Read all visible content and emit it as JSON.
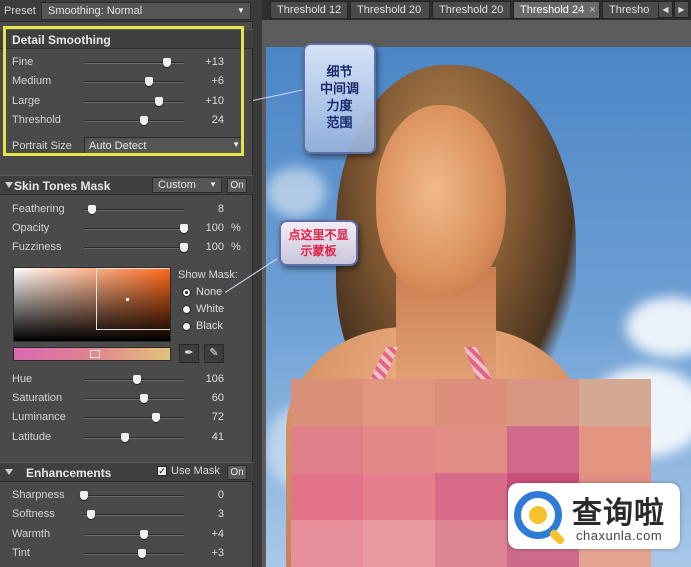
{
  "preset": {
    "label": "Preset",
    "value": "Smoothing: Normal"
  },
  "detail_smoothing": {
    "title": "Detail Smoothing",
    "rows": [
      {
        "label": "Fine",
        "value": "+13",
        "level": 0.83
      },
      {
        "label": "Medium",
        "value": "+6",
        "level": 0.65
      },
      {
        "label": "Large",
        "value": "+10",
        "level": 0.75
      },
      {
        "label": "Threshold",
        "value": "24",
        "level": 0.6
      }
    ],
    "portrait_label": "Portrait Size",
    "portrait_value": "Auto Detect"
  },
  "skin_tones": {
    "title": "Skin Tones Mask",
    "mode": "Custom",
    "on_label": "On",
    "rows": [
      {
        "label": "Feathering",
        "value": "8",
        "unit": "",
        "level": 0.08
      },
      {
        "label": "Opacity",
        "value": "100",
        "unit": "%",
        "level": 1.0
      },
      {
        "label": "Fuzziness",
        "value": "100",
        "unit": "%",
        "level": 1.0
      }
    ],
    "show_mask_label": "Show Mask:",
    "mask_options": [
      {
        "label": "None",
        "selected": true
      },
      {
        "label": "White",
        "selected": false
      },
      {
        "label": "Black",
        "selected": false
      }
    ],
    "hsl_rows": [
      {
        "label": "Hue",
        "value": "106",
        "level": 0.53
      },
      {
        "label": "Saturation",
        "value": "60",
        "level": 0.6
      },
      {
        "label": "Luminance",
        "value": "72",
        "level": 0.72
      },
      {
        "label": "Latitude",
        "value": "41",
        "level": 0.41
      }
    ]
  },
  "enhancements": {
    "title": "Enhancements",
    "use_mask_label": "Use Mask",
    "use_mask_checked": true,
    "on_label": "On",
    "rows": [
      {
        "label": "Sharpness",
        "value": "0",
        "level": 0.0
      },
      {
        "label": "Softness",
        "value": "3",
        "level": 0.07
      },
      {
        "label": "Warmth",
        "value": "+4",
        "level": 0.6
      },
      {
        "label": "Tint",
        "value": "+3",
        "level": 0.58
      }
    ]
  },
  "tabs": [
    {
      "label": "Threshold 12",
      "active": false,
      "closable": false
    },
    {
      "label": "Threshold 20",
      "active": false,
      "closable": false
    },
    {
      "label": "Threshold 20",
      "active": false,
      "closable": false
    },
    {
      "label": "Threshold 24",
      "active": true,
      "closable": true
    },
    {
      "label": "Thresho",
      "active": false,
      "closable": false
    }
  ],
  "tab_close": "×",
  "tab_nav": {
    "prev": "◀",
    "next": "▶"
  },
  "annotations": {
    "bubble1_lines": [
      "细节",
      "中间调",
      "力度",
      "范围"
    ],
    "bubble2_lines": [
      "点这里不显",
      "示蒙板"
    ]
  },
  "pixel_colors": [
    "#d98f78",
    "#e1967f",
    "#dc8f7a",
    "#d89583",
    "#d4a994",
    "#de7f8a",
    "#e38a86",
    "#e18d84",
    "#d1698a",
    "#e2967f",
    "#e27389",
    "#e47f8b",
    "#d86b8a",
    "#ca4f7a",
    "#e48f84",
    "#e88f9c",
    "#e89aa0",
    "#dd8492",
    "#cc6a8a",
    "#e5a490"
  ],
  "watermark": {
    "brand_cn": "查询啦",
    "brand_en": "chaxunla.com"
  },
  "colors": {
    "highlight_box": "#e7e34a",
    "annotation_text": "#e0224a",
    "sky": "#4c86c6"
  }
}
